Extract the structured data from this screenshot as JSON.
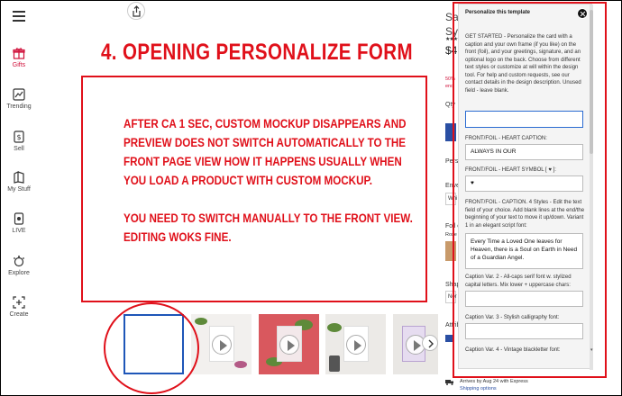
{
  "sidebar": {
    "items": [
      {
        "label": "Gifts",
        "icon": "gift-icon"
      },
      {
        "label": "Trending",
        "icon": "trending-chart-icon"
      },
      {
        "label": "Sell",
        "icon": "dollar-sell-icon"
      },
      {
        "label": "My Stuff",
        "icon": "my-stuff-icon"
      },
      {
        "label": "LIVE",
        "icon": "live-icon"
      },
      {
        "label": "Explore",
        "icon": "explore-icon"
      },
      {
        "label": "Create",
        "icon": "create-plus-icon"
      }
    ]
  },
  "annotation": {
    "headline": "4. OPENING PERSONALIZE FORM",
    "note_para1": "AFTER CA 1 SEC, CUSTOM MOCKUP DISAPPEARS AND PREVIEW DOES NOT SWITCH AUTOMATICALLY TO THE FRONT PAGE VIEW HOW IT HAPPENS USUALLY WHEN YOU LOAD A PRODUCT WITH CUSTOM MOCKUP.",
    "note_para2": "YOU NEED TO SWITCH MANUALLY TO THE FRONT VIEW. EDITING WOKS FINE.",
    "accent_color": "#e0101a"
  },
  "product": {
    "title_line1": "Sa",
    "title_line2": "Sy",
    "price": "$4.",
    "stars": "★★★★",
    "sale_line1": "50%",
    "sale_line2": "endi",
    "qty_label": "Qty",
    "perso_label": "Perso",
    "enve_label": "Enve",
    "whi_label": "Whi",
    "foil_label": "Foil c",
    "rose_label": "Rose",
    "shape_label": "Shap",
    "nor_label": "Nor",
    "attrib_label": "Attrib",
    "shipping_line": "Arrives by Aug 24 with Express",
    "shipping_link": "Shipping options"
  },
  "panel": {
    "title": "Personalize this template",
    "intro": "GET STARTED - Personalize the card with a caption and your own frame (if you like) on the front (foil), and your greetings, signature, and an optional logo on the back. Choose from different text styles or customize at will within the design tool. For help and custom requests, see our contact details in the design description. Unused field - leave blank.",
    "fields": [
      {
        "label": "",
        "value": ""
      },
      {
        "label": "FRONT/FOIL - HEART CAPTION:",
        "value": "ALWAYS IN OUR"
      },
      {
        "label": "FRONT/FOIL - HEART SYMBOL [ ♥ ]:",
        "value": "♥"
      },
      {
        "label": "FRONT/FOIL - CAPTION. 4 Styles - Edit the text field of your choice. Add blank lines at the end/the beginning of your text to move it up/down. Variant 1 in an elegant script font:",
        "value": "Every Time a Loved One leaves for Heaven, there is a Soul on Earth in Need of a Guardian Angel."
      },
      {
        "label": "Caption Var. 2 - All-caps serif font w. stylized capital letters. Mix lower + uppercase chars:",
        "value": ""
      },
      {
        "label": "Caption Var. 3 - Stylish calligraphy font:",
        "value": ""
      },
      {
        "label": "Caption Var. 4 - Vintage blackletter font:",
        "value": ""
      }
    ]
  },
  "colors": {
    "brand_red": "#d0103a",
    "link_blue": "#2a4fa3",
    "focus_blue": "#2a6bd1"
  }
}
